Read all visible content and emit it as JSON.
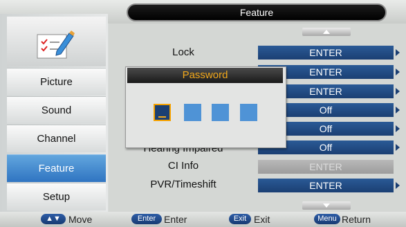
{
  "header": {
    "title": "Feature"
  },
  "sidebar": {
    "items": [
      {
        "label": "Picture"
      },
      {
        "label": "Sound"
      },
      {
        "label": "Channel"
      },
      {
        "label": "Feature",
        "active": true
      },
      {
        "label": "Setup"
      }
    ]
  },
  "rows": [
    {
      "label": "Lock",
      "value": "ENTER"
    },
    {
      "label": "",
      "value": "ENTER"
    },
    {
      "label": "",
      "value": "ENTER"
    },
    {
      "label": "",
      "value": "Off"
    },
    {
      "label": "",
      "value": "Off"
    },
    {
      "label": "Hearing Impaired",
      "value": "Off"
    },
    {
      "label": "CI Info",
      "value": "ENTER",
      "disabled": true
    },
    {
      "label": "PVR/Timeshift",
      "value": "ENTER"
    }
  ],
  "dialog": {
    "title": "Password"
  },
  "footer": {
    "move_key": "▲▼",
    "move": "Move",
    "enter_key": "Enter",
    "enter": "Enter",
    "exit_key": "Exit",
    "exit": "Exit",
    "menu_key": "Menu",
    "return": "Return"
  },
  "colors": {
    "accent": "#2f74c1",
    "value_bg": "#1b3f73",
    "dialog_title": "#f2a81a"
  }
}
